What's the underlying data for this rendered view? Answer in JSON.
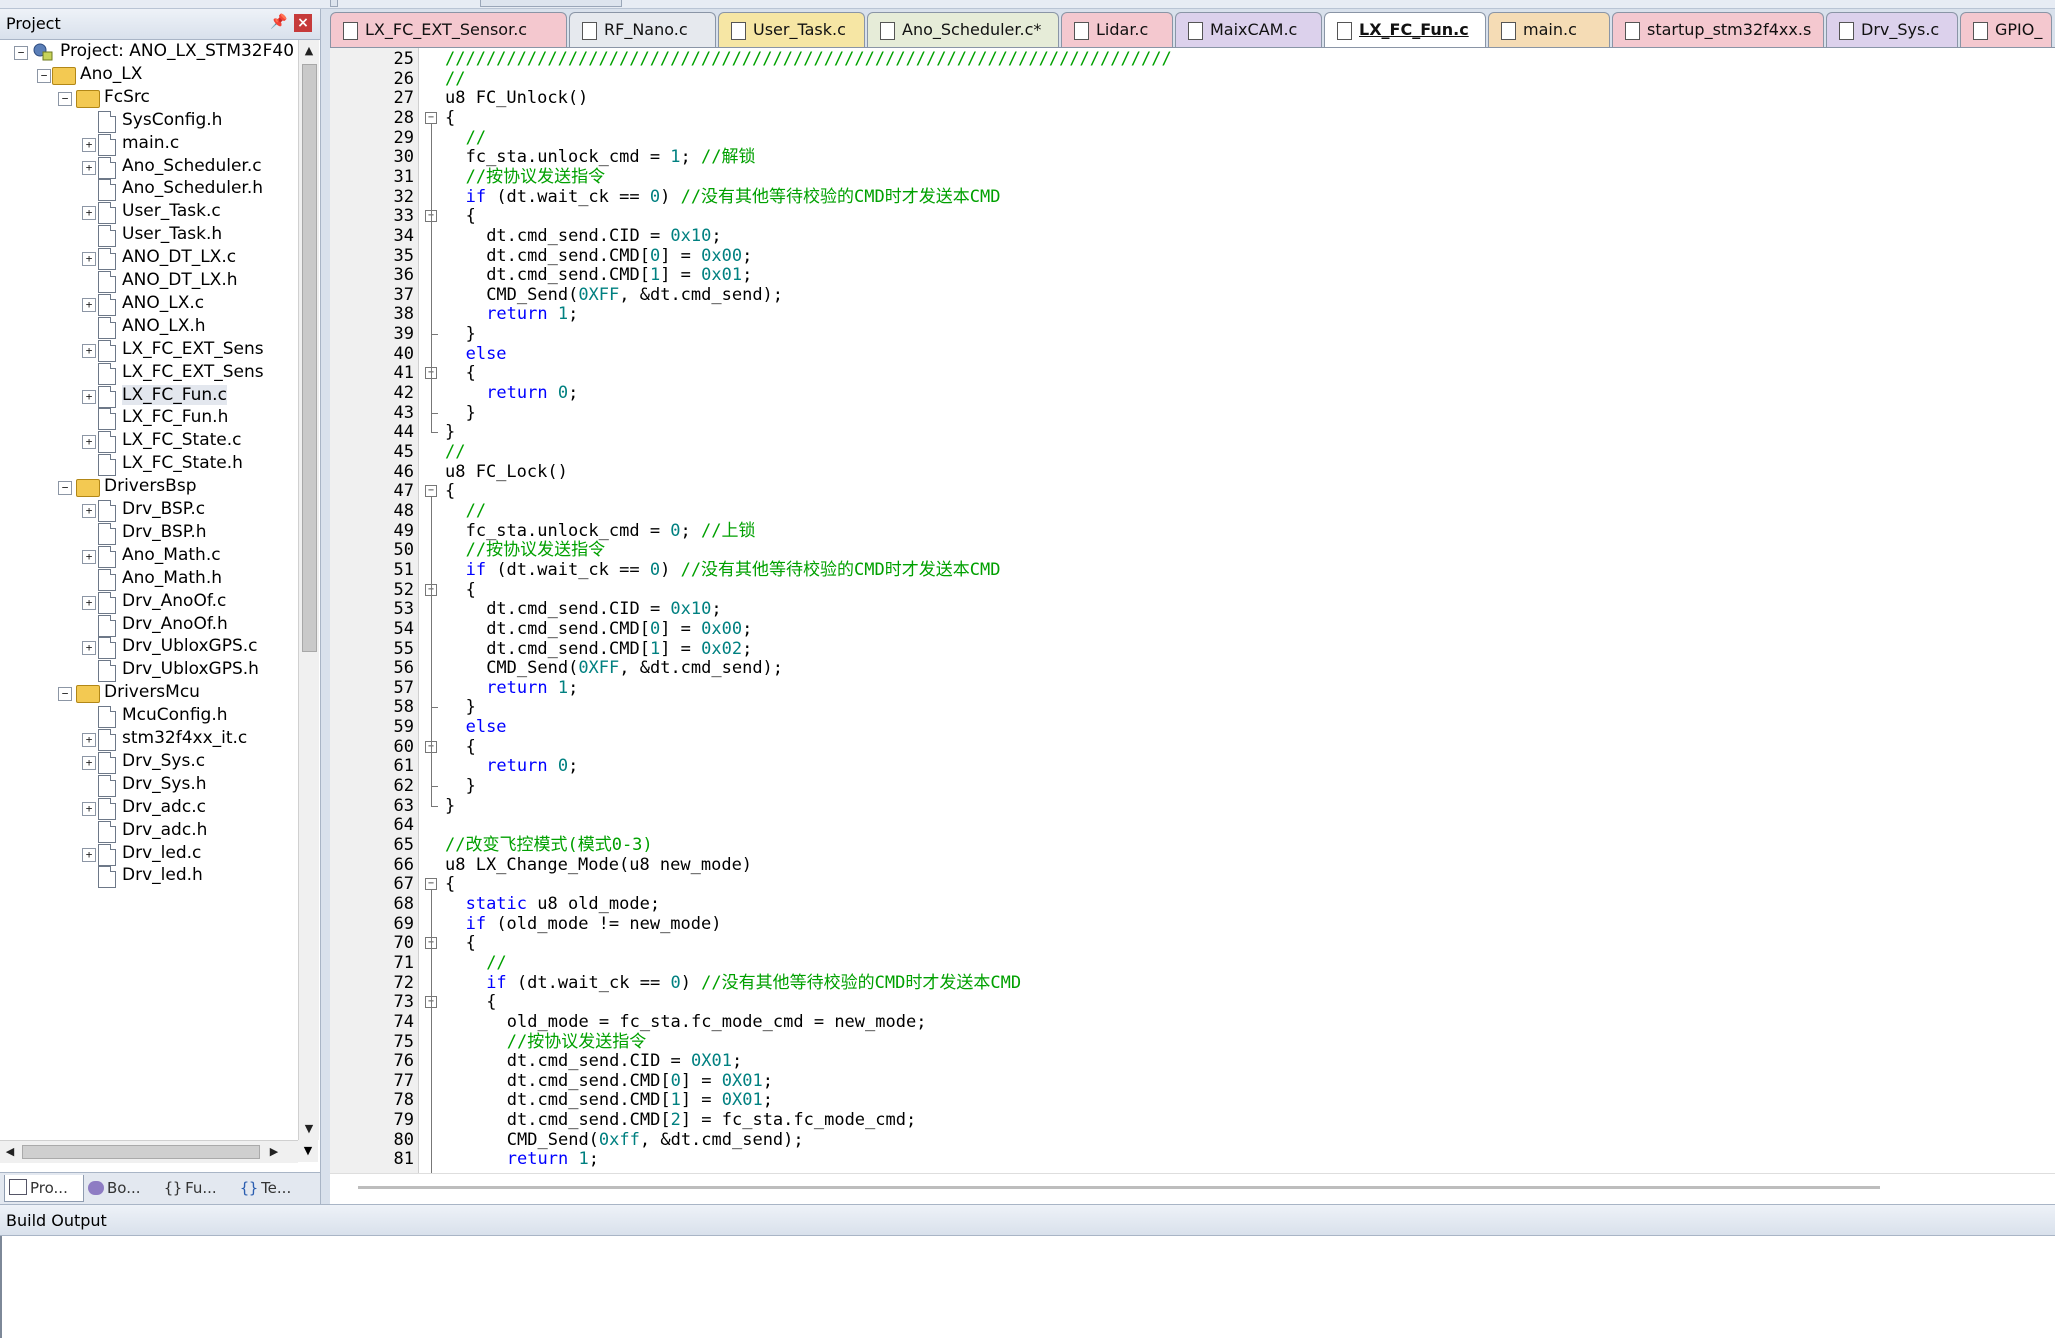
{
  "project_panel": {
    "title": "Project",
    "tree": [
      {
        "label": "Project: ANO_LX_STM32F40",
        "level": 0,
        "kind": "project",
        "expand": "-"
      },
      {
        "label": "Ano_LX",
        "level": 1,
        "kind": "dir",
        "expand": "-"
      },
      {
        "label": "FcSrc",
        "level": 2,
        "kind": "dir",
        "expand": "-"
      },
      {
        "label": "SysConfig.h",
        "level": 3,
        "kind": "file",
        "expand": ""
      },
      {
        "label": "main.c",
        "level": 3,
        "kind": "file",
        "expand": "+"
      },
      {
        "label": "Ano_Scheduler.c",
        "level": 3,
        "kind": "file",
        "expand": "+"
      },
      {
        "label": "Ano_Scheduler.h",
        "level": 3,
        "kind": "file",
        "expand": ""
      },
      {
        "label": "User_Task.c",
        "level": 3,
        "kind": "file",
        "expand": "+"
      },
      {
        "label": "User_Task.h",
        "level": 3,
        "kind": "file",
        "expand": ""
      },
      {
        "label": "ANO_DT_LX.c",
        "level": 3,
        "kind": "file",
        "expand": "+"
      },
      {
        "label": "ANO_DT_LX.h",
        "level": 3,
        "kind": "file",
        "expand": ""
      },
      {
        "label": "ANO_LX.c",
        "level": 3,
        "kind": "file",
        "expand": "+"
      },
      {
        "label": "ANO_LX.h",
        "level": 3,
        "kind": "file",
        "expand": ""
      },
      {
        "label": "LX_FC_EXT_Sens",
        "level": 3,
        "kind": "file",
        "expand": "+"
      },
      {
        "label": "LX_FC_EXT_Sens",
        "level": 3,
        "kind": "file",
        "expand": ""
      },
      {
        "label": "LX_FC_Fun.c",
        "level": 3,
        "kind": "file",
        "expand": "+",
        "selected": true
      },
      {
        "label": "LX_FC_Fun.h",
        "level": 3,
        "kind": "file",
        "expand": ""
      },
      {
        "label": "LX_FC_State.c",
        "level": 3,
        "kind": "file",
        "expand": "+"
      },
      {
        "label": "LX_FC_State.h",
        "level": 3,
        "kind": "file",
        "expand": ""
      },
      {
        "label": "DriversBsp",
        "level": 2,
        "kind": "dir",
        "expand": "-"
      },
      {
        "label": "Drv_BSP.c",
        "level": 3,
        "kind": "file",
        "expand": "+"
      },
      {
        "label": "Drv_BSP.h",
        "level": 3,
        "kind": "file",
        "expand": ""
      },
      {
        "label": "Ano_Math.c",
        "level": 3,
        "kind": "file",
        "expand": "+"
      },
      {
        "label": "Ano_Math.h",
        "level": 3,
        "kind": "file",
        "expand": ""
      },
      {
        "label": "Drv_AnoOf.c",
        "level": 3,
        "kind": "file",
        "expand": "+"
      },
      {
        "label": "Drv_AnoOf.h",
        "level": 3,
        "kind": "file",
        "expand": ""
      },
      {
        "label": "Drv_UbloxGPS.c",
        "level": 3,
        "kind": "file",
        "expand": "+"
      },
      {
        "label": "Drv_UbloxGPS.h",
        "level": 3,
        "kind": "file",
        "expand": ""
      },
      {
        "label": "DriversMcu",
        "level": 2,
        "kind": "dir",
        "expand": "-"
      },
      {
        "label": "McuConfig.h",
        "level": 3,
        "kind": "file",
        "expand": ""
      },
      {
        "label": "stm32f4xx_it.c",
        "level": 3,
        "kind": "file",
        "expand": "+"
      },
      {
        "label": "Drv_Sys.c",
        "level": 3,
        "kind": "file",
        "expand": "+"
      },
      {
        "label": "Drv_Sys.h",
        "level": 3,
        "kind": "file",
        "expand": ""
      },
      {
        "label": "Drv_adc.c",
        "level": 3,
        "kind": "file",
        "expand": "+"
      },
      {
        "label": "Drv_adc.h",
        "level": 3,
        "kind": "file",
        "expand": ""
      },
      {
        "label": "Drv_led.c",
        "level": 3,
        "kind": "file",
        "expand": "+"
      },
      {
        "label": "Drv_led.h",
        "level": 3,
        "kind": "file",
        "expand": ""
      }
    ],
    "bottom_tabs": [
      "Pro...",
      "Bo...",
      "Fu...",
      "Te..."
    ]
  },
  "tabs": [
    {
      "label": "LX_FC_EXT_Sensor.c",
      "color": "#f4c8cf"
    },
    {
      "label": "RF_Nano.c",
      "color": "#e6e9ee"
    },
    {
      "label": "User_Task.c",
      "color": "#f6e6a4"
    },
    {
      "label": "Ano_Scheduler.c*",
      "color": "#e6ecd8"
    },
    {
      "label": "Lidar.c",
      "color": "#f4c8cf"
    },
    {
      "label": "MaixCAM.c",
      "color": "#dcd1ec"
    },
    {
      "label": "LX_FC_Fun.c",
      "color": "#d3ece4",
      "active": true
    },
    {
      "label": "main.c",
      "color": "#f5dcb5"
    },
    {
      "label": "startup_stm32f4xx.s",
      "color": "#f4c8cf"
    },
    {
      "label": "Drv_Sys.c",
      "color": "#dcd1ec"
    },
    {
      "label": "GPIO_",
      "color": "#f4c8cf"
    }
  ],
  "editor": {
    "lines": [
      {
        "n": "25",
        "indent": 0,
        "segs": [
          [
            "c",
            "///////////////////////////////////////////////////////////////////////"
          ]
        ]
      },
      {
        "n": "26",
        "indent": 0,
        "segs": [
          [
            "c",
            "//"
          ]
        ]
      },
      {
        "n": "27",
        "indent": 0,
        "segs": [
          [
            "t",
            "u8 FC_Unlock()"
          ]
        ]
      },
      {
        "n": "28",
        "indent": 0,
        "segs": [
          [
            "t",
            "{"
          ]
        ],
        "fold": "open"
      },
      {
        "n": "29",
        "indent": 2,
        "segs": [
          [
            "c",
            "//"
          ]
        ]
      },
      {
        "n": "30",
        "indent": 2,
        "segs": [
          [
            "t",
            "fc_sta.unlock_cmd = "
          ],
          [
            "n",
            "1"
          ],
          [
            "t",
            "; "
          ],
          [
            "c",
            "//解锁"
          ]
        ]
      },
      {
        "n": "31",
        "indent": 2,
        "segs": [
          [
            "c",
            "//按协议发送指令"
          ]
        ]
      },
      {
        "n": "32",
        "indent": 2,
        "segs": [
          [
            "k",
            "if"
          ],
          [
            "t",
            " (dt.wait_ck == "
          ],
          [
            "n",
            "0"
          ],
          [
            "t",
            ") "
          ],
          [
            "c",
            "//没有其他等待校验的CMD时才发送本CMD"
          ]
        ]
      },
      {
        "n": "33",
        "indent": 2,
        "segs": [
          [
            "t",
            "{"
          ]
        ],
        "fold": "open"
      },
      {
        "n": "34",
        "indent": 4,
        "segs": [
          [
            "t",
            "dt.cmd_send.CID = "
          ],
          [
            "n",
            "0x10"
          ],
          [
            "t",
            ";"
          ]
        ]
      },
      {
        "n": "35",
        "indent": 4,
        "segs": [
          [
            "t",
            "dt.cmd_send.CMD["
          ],
          [
            "n",
            "0"
          ],
          [
            "t",
            "] = "
          ],
          [
            "n",
            "0x00"
          ],
          [
            "t",
            ";"
          ]
        ]
      },
      {
        "n": "36",
        "indent": 4,
        "segs": [
          [
            "t",
            "dt.cmd_send.CMD["
          ],
          [
            "n",
            "1"
          ],
          [
            "t",
            "] = "
          ],
          [
            "n",
            "0x01"
          ],
          [
            "t",
            ";"
          ]
        ]
      },
      {
        "n": "37",
        "indent": 4,
        "segs": [
          [
            "t",
            "CMD_Send("
          ],
          [
            "n",
            "0XFF"
          ],
          [
            "t",
            ", &dt.cmd_send);"
          ]
        ]
      },
      {
        "n": "38",
        "indent": 4,
        "segs": [
          [
            "k",
            "return"
          ],
          [
            "t",
            " "
          ],
          [
            "n",
            "1"
          ],
          [
            "t",
            ";"
          ]
        ]
      },
      {
        "n": "39",
        "indent": 2,
        "segs": [
          [
            "t",
            "}"
          ]
        ],
        "fold": "end"
      },
      {
        "n": "40",
        "indent": 2,
        "segs": [
          [
            "k",
            "else"
          ]
        ]
      },
      {
        "n": "41",
        "indent": 2,
        "segs": [
          [
            "t",
            "{"
          ]
        ],
        "fold": "open"
      },
      {
        "n": "42",
        "indent": 4,
        "segs": [
          [
            "k",
            "return"
          ],
          [
            "t",
            " "
          ],
          [
            "n",
            "0"
          ],
          [
            "t",
            ";"
          ]
        ]
      },
      {
        "n": "43",
        "indent": 2,
        "segs": [
          [
            "t",
            "}"
          ]
        ],
        "fold": "end"
      },
      {
        "n": "44",
        "indent": 0,
        "segs": [
          [
            "t",
            "}"
          ]
        ],
        "fold": "end"
      },
      {
        "n": "45",
        "indent": 0,
        "segs": [
          [
            "c",
            "//"
          ]
        ]
      },
      {
        "n": "46",
        "indent": 0,
        "segs": [
          [
            "t",
            "u8 FC_Lock()"
          ]
        ]
      },
      {
        "n": "47",
        "indent": 0,
        "segs": [
          [
            "t",
            "{"
          ]
        ],
        "fold": "open"
      },
      {
        "n": "48",
        "indent": 2,
        "segs": [
          [
            "c",
            "//"
          ]
        ]
      },
      {
        "n": "49",
        "indent": 2,
        "segs": [
          [
            "t",
            "fc_sta.unlock_cmd = "
          ],
          [
            "n",
            "0"
          ],
          [
            "t",
            "; "
          ],
          [
            "c",
            "//上锁"
          ]
        ]
      },
      {
        "n": "50",
        "indent": 2,
        "segs": [
          [
            "c",
            "//按协议发送指令"
          ]
        ]
      },
      {
        "n": "51",
        "indent": 2,
        "segs": [
          [
            "k",
            "if"
          ],
          [
            "t",
            " (dt.wait_ck == "
          ],
          [
            "n",
            "0"
          ],
          [
            "t",
            ") "
          ],
          [
            "c",
            "//没有其他等待校验的CMD时才发送本CMD"
          ]
        ]
      },
      {
        "n": "52",
        "indent": 2,
        "segs": [
          [
            "t",
            "{"
          ]
        ],
        "fold": "open"
      },
      {
        "n": "53",
        "indent": 4,
        "segs": [
          [
            "t",
            "dt.cmd_send.CID = "
          ],
          [
            "n",
            "0x10"
          ],
          [
            "t",
            ";"
          ]
        ]
      },
      {
        "n": "54",
        "indent": 4,
        "segs": [
          [
            "t",
            "dt.cmd_send.CMD["
          ],
          [
            "n",
            "0"
          ],
          [
            "t",
            "] = "
          ],
          [
            "n",
            "0x00"
          ],
          [
            "t",
            ";"
          ]
        ]
      },
      {
        "n": "55",
        "indent": 4,
        "segs": [
          [
            "t",
            "dt.cmd_send.CMD["
          ],
          [
            "n",
            "1"
          ],
          [
            "t",
            "] = "
          ],
          [
            "n",
            "0x02"
          ],
          [
            "t",
            ";"
          ]
        ]
      },
      {
        "n": "56",
        "indent": 4,
        "segs": [
          [
            "t",
            "CMD_Send("
          ],
          [
            "n",
            "0XFF"
          ],
          [
            "t",
            ", &dt.cmd_send);"
          ]
        ]
      },
      {
        "n": "57",
        "indent": 4,
        "segs": [
          [
            "k",
            "return"
          ],
          [
            "t",
            " "
          ],
          [
            "n",
            "1"
          ],
          [
            "t",
            ";"
          ]
        ]
      },
      {
        "n": "58",
        "indent": 2,
        "segs": [
          [
            "t",
            "}"
          ]
        ],
        "fold": "end"
      },
      {
        "n": "59",
        "indent": 2,
        "segs": [
          [
            "k",
            "else"
          ]
        ]
      },
      {
        "n": "60",
        "indent": 2,
        "segs": [
          [
            "t",
            "{"
          ]
        ],
        "fold": "open"
      },
      {
        "n": "61",
        "indent": 4,
        "segs": [
          [
            "k",
            "return"
          ],
          [
            "t",
            " "
          ],
          [
            "n",
            "0"
          ],
          [
            "t",
            ";"
          ]
        ]
      },
      {
        "n": "62",
        "indent": 2,
        "segs": [
          [
            "t",
            "}"
          ]
        ],
        "fold": "end"
      },
      {
        "n": "63",
        "indent": 0,
        "segs": [
          [
            "t",
            "}"
          ]
        ],
        "fold": "end"
      },
      {
        "n": "64",
        "indent": 0,
        "segs": []
      },
      {
        "n": "65",
        "indent": 0,
        "segs": [
          [
            "c",
            "//改变飞控模式(模式0-3)"
          ]
        ]
      },
      {
        "n": "66",
        "indent": 0,
        "segs": [
          [
            "t",
            "u8 LX_Change_Mode(u8 new_mode)"
          ]
        ]
      },
      {
        "n": "67",
        "indent": 0,
        "segs": [
          [
            "t",
            "{"
          ]
        ],
        "fold": "open"
      },
      {
        "n": "68",
        "indent": 2,
        "segs": [
          [
            "k",
            "static"
          ],
          [
            "t",
            " u8 old_mode;"
          ]
        ]
      },
      {
        "n": "69",
        "indent": 2,
        "segs": [
          [
            "k",
            "if"
          ],
          [
            "t",
            " (old_mode != new_mode)"
          ]
        ]
      },
      {
        "n": "70",
        "indent": 2,
        "segs": [
          [
            "t",
            "{"
          ]
        ],
        "fold": "open"
      },
      {
        "n": "71",
        "indent": 4,
        "segs": [
          [
            "c",
            "//"
          ]
        ]
      },
      {
        "n": "72",
        "indent": 4,
        "segs": [
          [
            "k",
            "if"
          ],
          [
            "t",
            " (dt.wait_ck == "
          ],
          [
            "n",
            "0"
          ],
          [
            "t",
            ") "
          ],
          [
            "c",
            "//没有其他等待校验的CMD时才发送本CMD"
          ]
        ]
      },
      {
        "n": "73",
        "indent": 4,
        "segs": [
          [
            "t",
            "{"
          ]
        ],
        "fold": "open"
      },
      {
        "n": "74",
        "indent": 6,
        "segs": [
          [
            "t",
            "old_mode = fc_sta.fc_mode_cmd = new_mode;"
          ]
        ]
      },
      {
        "n": "75",
        "indent": 6,
        "segs": [
          [
            "c",
            "//按协议发送指令"
          ]
        ]
      },
      {
        "n": "76",
        "indent": 6,
        "segs": [
          [
            "t",
            "dt.cmd_send.CID = "
          ],
          [
            "n",
            "0X01"
          ],
          [
            "t",
            ";"
          ]
        ]
      },
      {
        "n": "77",
        "indent": 6,
        "segs": [
          [
            "t",
            "dt.cmd_send.CMD["
          ],
          [
            "n",
            "0"
          ],
          [
            "t",
            "] = "
          ],
          [
            "n",
            "0X01"
          ],
          [
            "t",
            ";"
          ]
        ]
      },
      {
        "n": "78",
        "indent": 6,
        "segs": [
          [
            "t",
            "dt.cmd_send.CMD["
          ],
          [
            "n",
            "1"
          ],
          [
            "t",
            "] = "
          ],
          [
            "n",
            "0X01"
          ],
          [
            "t",
            ";"
          ]
        ]
      },
      {
        "n": "79",
        "indent": 6,
        "segs": [
          [
            "t",
            "dt.cmd_send.CMD["
          ],
          [
            "n",
            "2"
          ],
          [
            "t",
            "] = fc_sta.fc_mode_cmd;"
          ]
        ]
      },
      {
        "n": "80",
        "indent": 6,
        "segs": [
          [
            "t",
            "CMD_Send("
          ],
          [
            "n",
            "0xff"
          ],
          [
            "t",
            ", &dt.cmd_send);"
          ]
        ]
      },
      {
        "n": "81",
        "indent": 6,
        "segs": [
          [
            "k",
            "return"
          ],
          [
            "t",
            " "
          ],
          [
            "n",
            "1"
          ],
          [
            "t",
            ";"
          ]
        ]
      }
    ]
  },
  "build_output": {
    "title": "Build Output"
  }
}
